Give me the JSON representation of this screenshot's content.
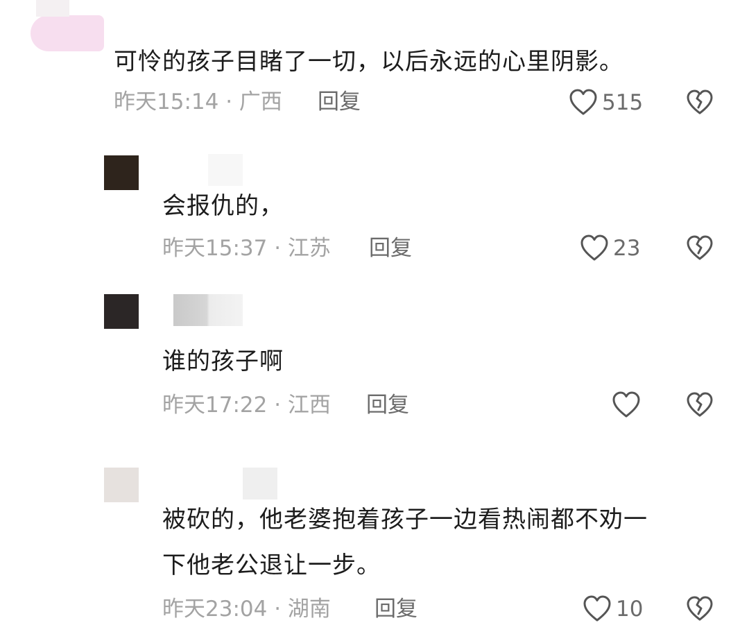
{
  "comments": [
    {
      "text": "可怜的孩子目睹了一切，以后永远的心里阴影。",
      "meta": "昨天15:14 · 广西",
      "reply_label": "回复",
      "likes": "515",
      "avatar_color": "#f6d8ec"
    },
    {
      "text": "会报仇的，",
      "meta": "昨天15:37 · 江苏",
      "reply_label": "回复",
      "likes": "23",
      "avatar_color": "#2e241c"
    },
    {
      "text": "谁的孩子啊",
      "meta": "昨天17:22 · 江西",
      "reply_label": "回复",
      "likes": "",
      "avatar_color": "#2b2626"
    },
    {
      "text": "被砍的，他老婆抱着孩子一边看热闹都不劝一\n下他老公退让一步。",
      "meta": "昨天23:04 · 湖南",
      "reply_label": "回复",
      "likes": "10",
      "avatar_color": "#e6e1de"
    }
  ],
  "colors": {
    "meta_text": "#a3a3a3",
    "action_text": "#6b6b6b",
    "icon_stroke": "#555555"
  },
  "icons": {
    "like": "heart-outline-icon",
    "dislike": "broken-heart-icon"
  }
}
